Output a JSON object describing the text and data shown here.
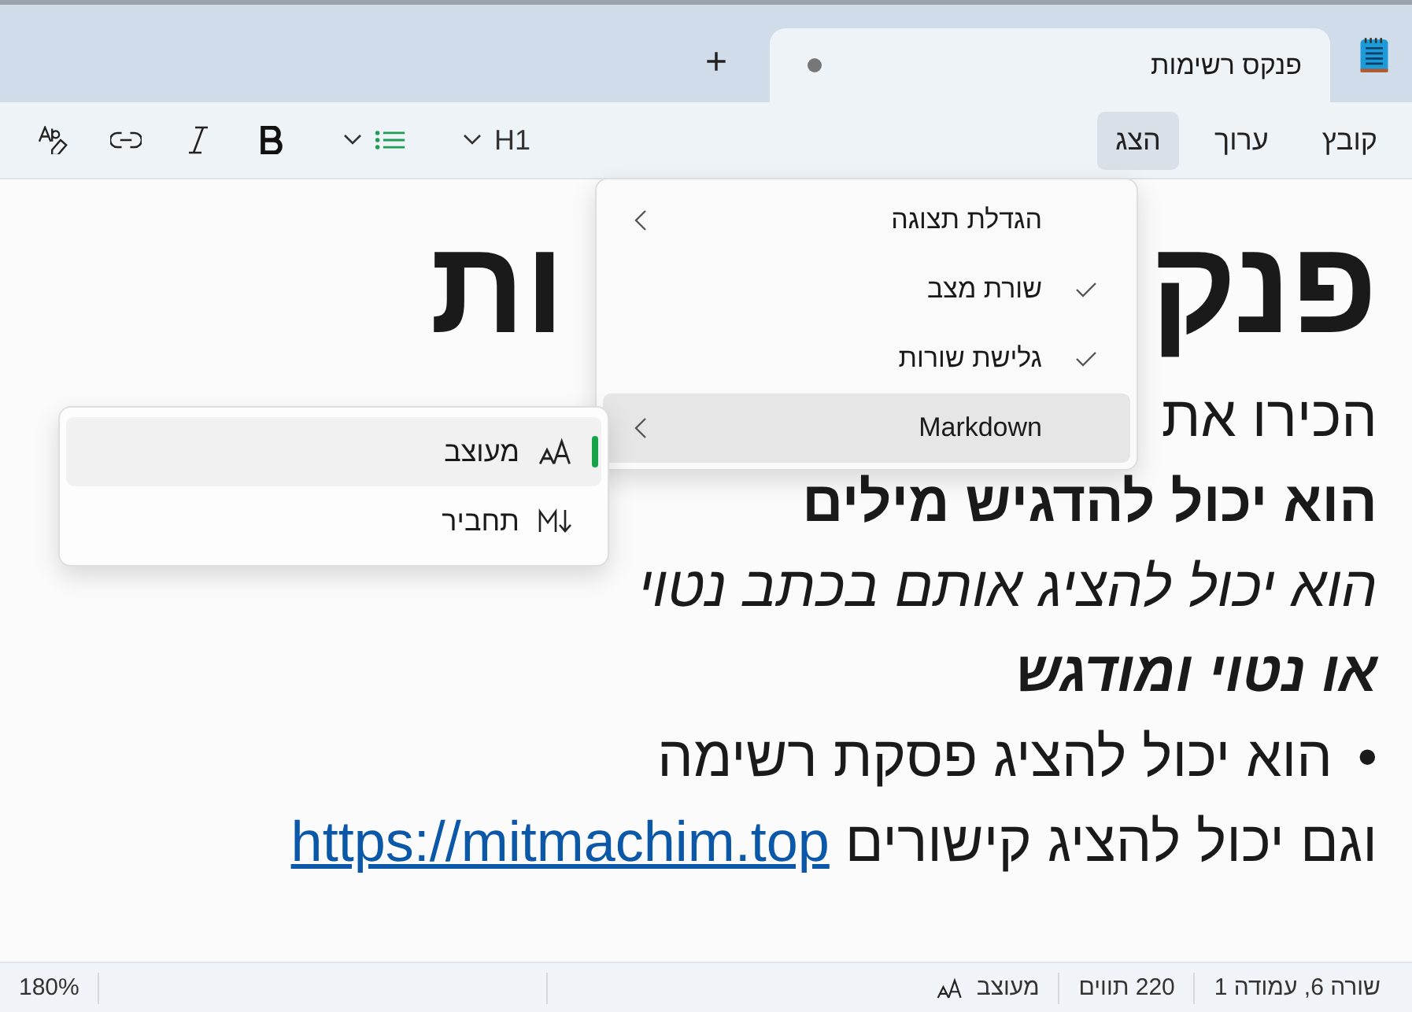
{
  "tabs": [
    {
      "title": "פנקס רשימות",
      "unsaved": true,
      "selected": true
    }
  ],
  "new_tab": "+",
  "menu_bar": [
    {
      "label": "קובץ",
      "selected": false
    },
    {
      "label": "ערוך",
      "selected": false
    },
    {
      "label": "הצג",
      "selected": true
    }
  ],
  "toolbar": [
    {
      "kind": "heading",
      "label": "H1"
    },
    {
      "kind": "list"
    },
    {
      "kind": "bold"
    },
    {
      "kind": "italic"
    },
    {
      "kind": "link"
    },
    {
      "kind": "clear"
    }
  ],
  "document": [
    {
      "kind": "heading",
      "parts": [
        "פנק",
        "ות"
      ]
    },
    {
      "kind": "plain",
      "parts": [
        "הכירו את"
      ]
    },
    {
      "kind": "bold",
      "parts": [
        "הוא יכול להדגיש מילים"
      ]
    },
    {
      "kind": "italic",
      "parts": [
        "הוא יכול להציג אותם בכתב נטוי"
      ]
    },
    {
      "kind": "bold-italic",
      "parts": [
        "או נטוי ומודגש"
      ]
    },
    {
      "kind": "bullet",
      "bullet": "•",
      "parts": [
        "הוא יכול להציג פסקת רשימה"
      ]
    },
    {
      "kind": "link",
      "parts": [
        "וגם יכול להציג קישורים"
      ],
      "link": "https://mitmachim.top"
    }
  ],
  "view_menu": [
    {
      "kind": "submenu",
      "label": "הגדלת תצוגה",
      "expanded": false
    },
    {
      "kind": "toggle",
      "label": "שורת מצב",
      "checked": true
    },
    {
      "kind": "toggle",
      "label": "גלישת שורות",
      "checked": true
    },
    {
      "kind": "submenu",
      "label": "Markdown",
      "expanded": true
    }
  ],
  "markdown_menu": [
    {
      "kind": "formatted",
      "label": "מעוצב",
      "selected": true
    },
    {
      "kind": "syntax",
      "label": "תחביר",
      "selected": false
    }
  ],
  "status_bar": {
    "position": "שורה 6, עמודה 1",
    "characters": "220 תווים",
    "mode": "מעוצב",
    "zoom": "180%"
  }
}
